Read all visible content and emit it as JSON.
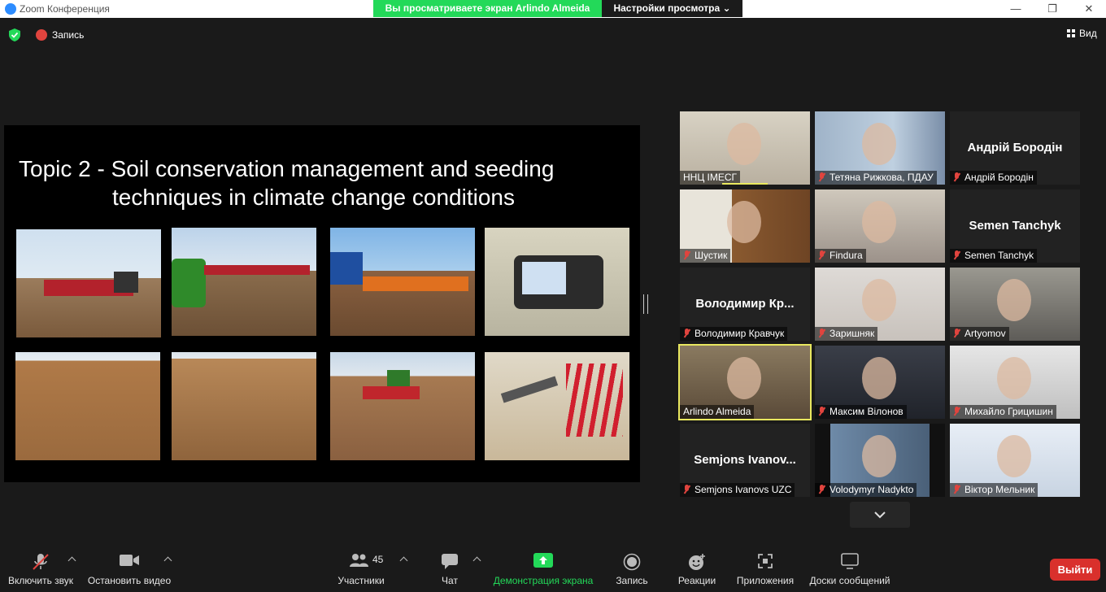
{
  "window": {
    "title": "Zoom Конференция"
  },
  "share": {
    "banner": "Вы просматриваете экран Arlindo Almeida",
    "view_options": "Настройки просмотра"
  },
  "topbar": {
    "record_label": "Запись",
    "view_label": "Вид"
  },
  "slide": {
    "title_line1": "Topic 2 - Soil conservation management and seeding",
    "title_line2": "techniques in climate change conditions"
  },
  "participants": [
    {
      "name": "ННЦ ІМЕСГ",
      "muted": false,
      "active": false,
      "video": true
    },
    {
      "name": "Тетяна Рижкова, ПДАУ",
      "muted": true,
      "active": false,
      "video": true
    },
    {
      "name": "Андрій Бородін",
      "display": "Андрій Бородін",
      "muted": true,
      "active": false,
      "video": false
    },
    {
      "name": "Шустик",
      "muted": true,
      "active": false,
      "video": true
    },
    {
      "name": "Findura",
      "muted": true,
      "active": false,
      "video": true
    },
    {
      "name": "Semen Tanchyk",
      "display": "Semen Tanchyk",
      "muted": true,
      "active": false,
      "video": false
    },
    {
      "name": "Володимир Кравчук",
      "display": "Володимир  Кр...",
      "muted": true,
      "active": false,
      "video": false
    },
    {
      "name": "Заришняк",
      "muted": true,
      "active": false,
      "video": true
    },
    {
      "name": "Artyomov",
      "muted": true,
      "active": false,
      "video": true
    },
    {
      "name": "Arlindo Almeida",
      "muted": false,
      "active": true,
      "video": true
    },
    {
      "name": "Максим Вілонов",
      "muted": true,
      "active": false,
      "video": true
    },
    {
      "name": "Михайло Грицишин",
      "muted": true,
      "active": false,
      "video": true
    },
    {
      "name": "Semjons Ivanovs UZC",
      "display": "Semjons  Ivanov...",
      "muted": true,
      "active": false,
      "video": false
    },
    {
      "name": "Volodymyr Nadykto",
      "muted": true,
      "active": false,
      "video": true
    },
    {
      "name": "Віктор Мельник",
      "muted": true,
      "active": false,
      "video": true
    }
  ],
  "toolbar": {
    "unmute": "Включить звук",
    "start_video": "Остановить видео",
    "participants_count": "45",
    "participants": "Участники",
    "chat": "Чат",
    "share_screen": "Демонстрация экрана",
    "record": "Запись",
    "reactions": "Реакции",
    "apps": "Приложения",
    "whiteboards": "Доски сообщений",
    "leave": "Выйти"
  },
  "colors": {
    "accent_green": "#23d959",
    "leave_red": "#d9302c",
    "active_speaker": "#e9e85f"
  }
}
